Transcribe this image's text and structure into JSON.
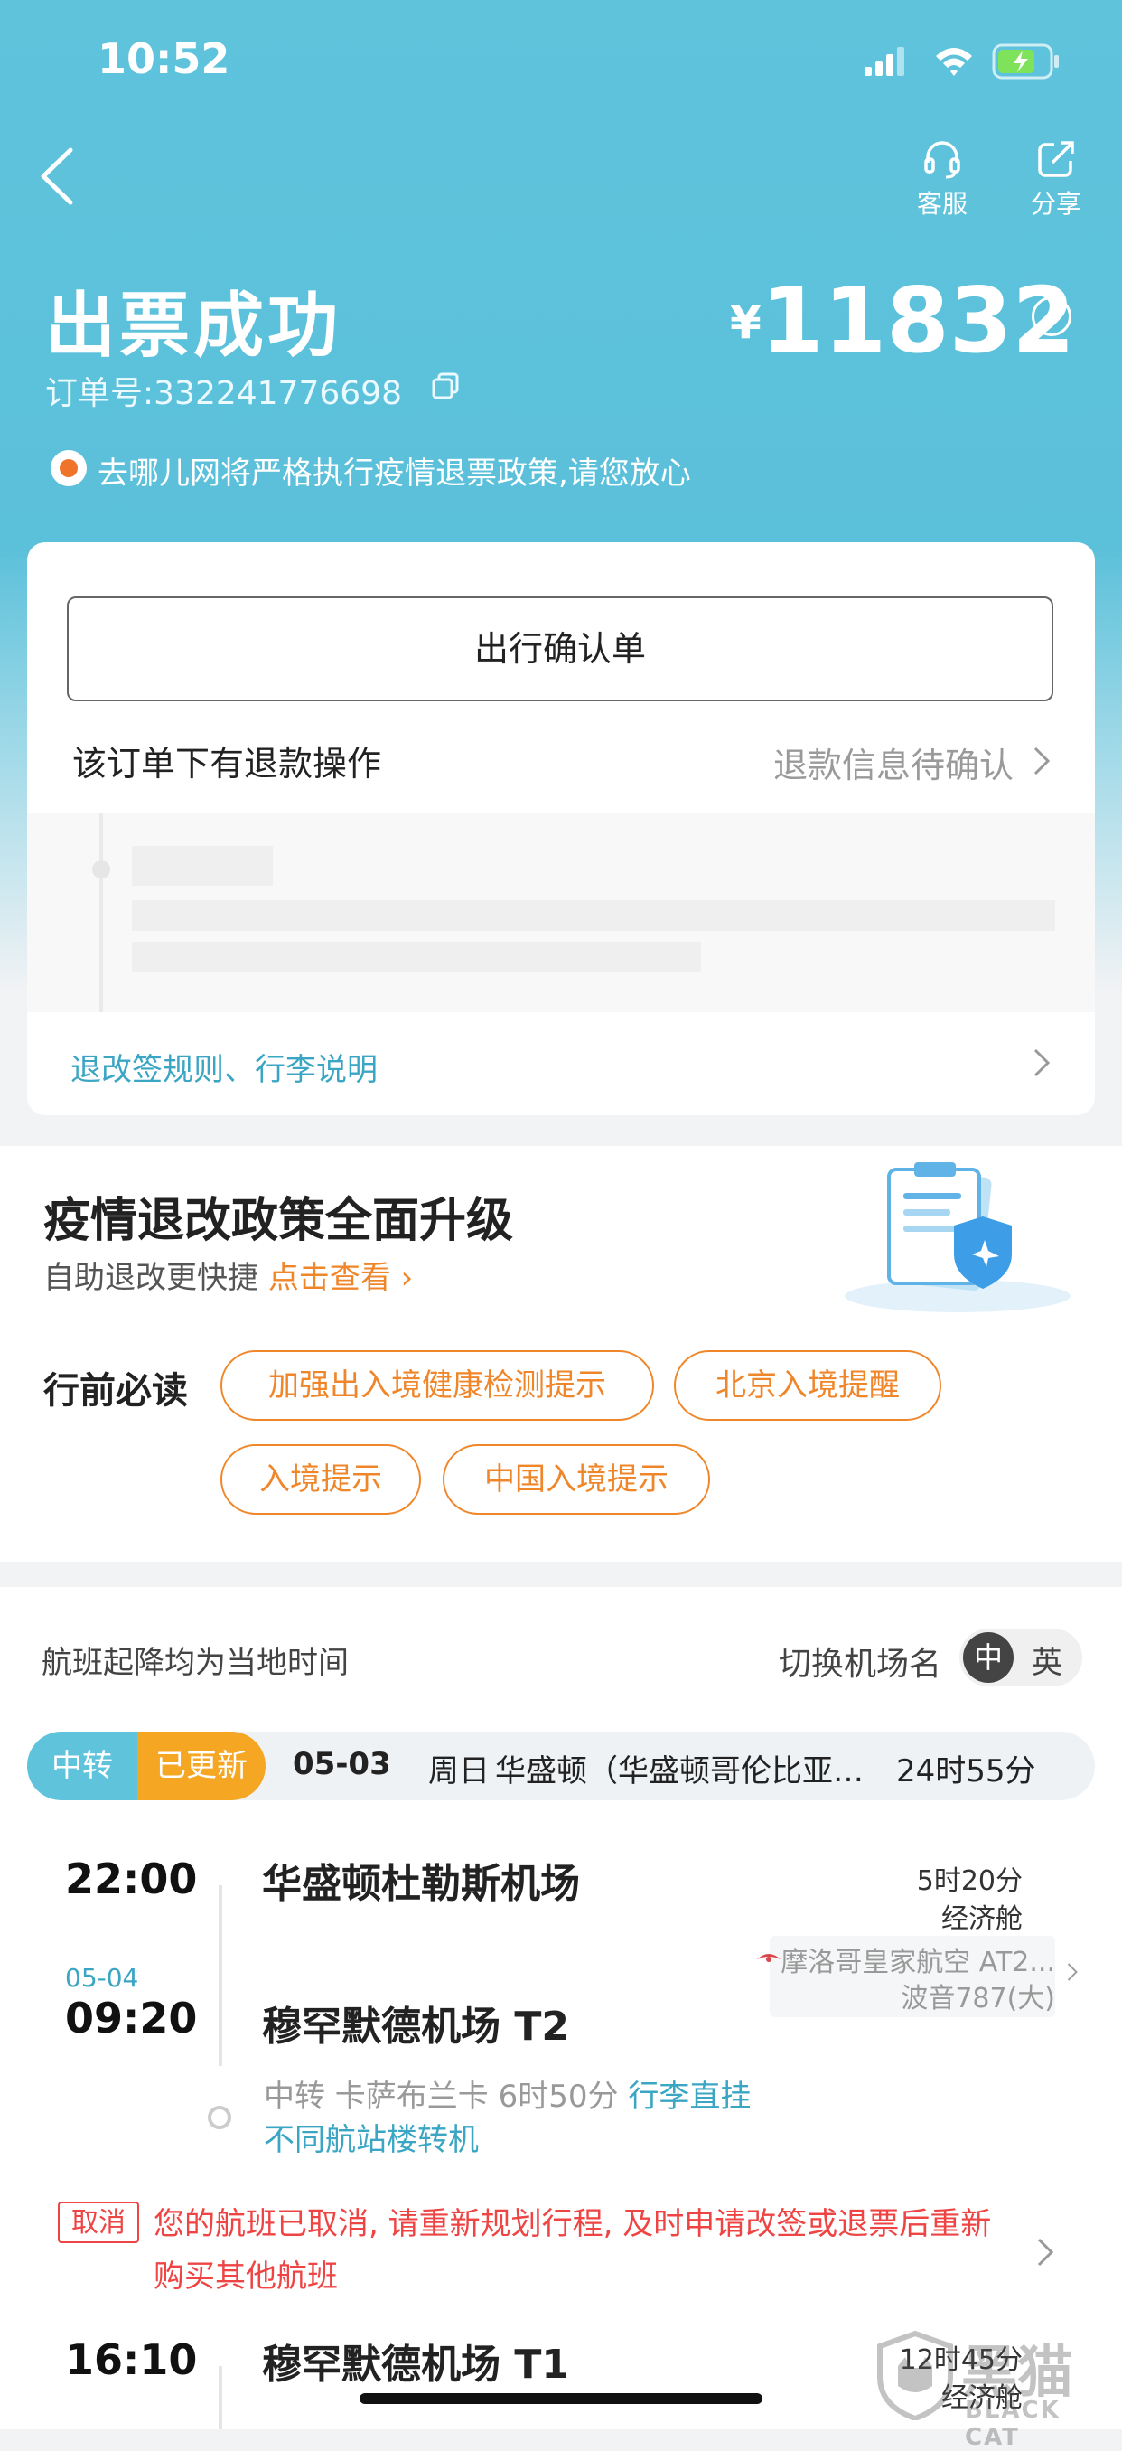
{
  "status": {
    "time": "10:52"
  },
  "header": {
    "service_label": "客服",
    "share_label": "分享",
    "title": "出票成功",
    "order_label": "订单号:332241776698",
    "price_symbol": "¥",
    "price": "11832",
    "info_icon": "i",
    "notice": "去哪儿网将严格执行疫情退票政策,请您放心"
  },
  "card": {
    "confirm_button": "出行确认单",
    "refund_label": "该订单下有退款操作",
    "refund_status": "退款信息待确认",
    "rules_link": "退改签规则、行李说明"
  },
  "policy": {
    "title": "疫情退改政策全面升级",
    "subtitle": "自助退改更快捷",
    "link": "点击查看 ›",
    "must_read": "行前必读",
    "tags": [
      "加强出入境健康检测提示",
      "北京入境提醒",
      "入境提示",
      "中国入境提示"
    ]
  },
  "flight": {
    "local_time_note": "航班起降均为当地时间",
    "switch_label": "切换机场名",
    "switch_zh": "中",
    "switch_en": "英",
    "route": {
      "transit_tag": "中转",
      "updated_tag": "已更新",
      "date": "05-03",
      "weekday": "周日",
      "cities": "华盛顿（华盛顿哥伦比亚…",
      "duration": "24时55分"
    },
    "seg1": {
      "dep_time": "22:00",
      "dep_airport": "华盛顿杜勒斯机场",
      "arr_date": "05-04",
      "arr_time": "09:20",
      "arr_airport": "穆罕默德机场 T2",
      "duration": "5时20分",
      "cabin": "经济舱",
      "airline": "摩洛哥皇家航空 AT2...",
      "aircraft": "波音787(大)"
    },
    "transit": {
      "text": "中转 卡萨布兰卡 6时50分",
      "baggage": "行李直挂",
      "terminal": "不同航站楼转机"
    },
    "cancel": {
      "tag": "取消",
      "message": "您的航班已取消, 请重新规划行程, 及时申请改签或退票后重新购买其他航班"
    },
    "seg2": {
      "dep_time": "16:10",
      "dep_airport": "穆罕默德机场 T1",
      "duration": "12时45分",
      "cabin": "经济舱"
    }
  },
  "watermark": {
    "brand": "黑猫",
    "brand_en": "BLACK CAT"
  }
}
